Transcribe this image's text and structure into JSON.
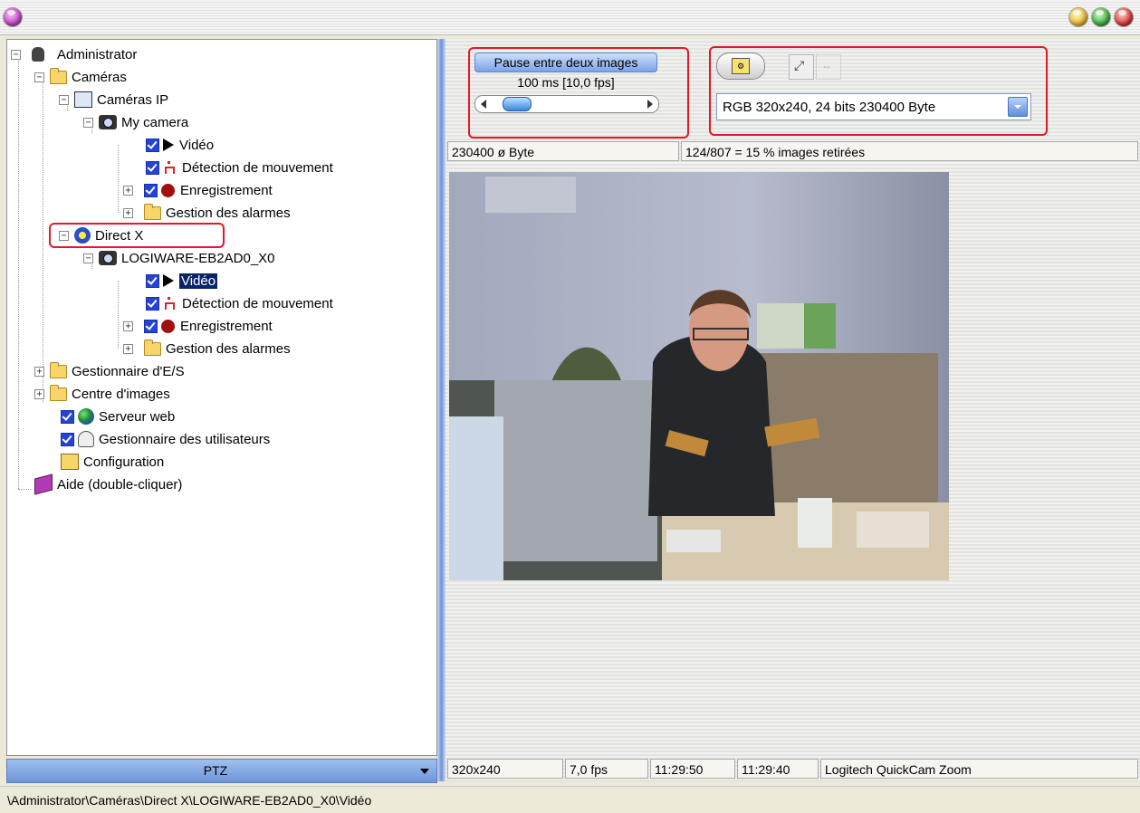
{
  "window": {
    "buttons": {
      "left": "#c94fcf",
      "yellow": "#f0c040",
      "green": "#45b845",
      "red": "#e04040"
    }
  },
  "tree": {
    "administrator": "Administrator",
    "cameras": "Caméras",
    "ip_cameras": "Caméras IP",
    "my_camera": "My camera",
    "video": "Vidéo",
    "motion": "Détection de mouvement",
    "recording": "Enregistrement",
    "alarms": "Gestion des alarmes",
    "directx": "Direct X",
    "device": "LOGIWARE-EB2AD0_X0",
    "video2": "Vidéo",
    "motion2": "Détection de mouvement",
    "recording2": "Enregistrement",
    "alarms2": "Gestion des alarmes",
    "io_manager": "Gestionnaire d'E/S",
    "image_center": "Centre d'images",
    "web_server": "Serveur web",
    "user_manager": "Gestionnaire des utilisateurs",
    "configuration": "Configuration",
    "help": "Aide (double-cliquer)"
  },
  "ptz": {
    "label": "PTZ"
  },
  "path": "\\Administrator\\Caméras\\Direct X\\LOGIWARE-EB2AD0_X0\\Vidéo",
  "pause": {
    "title": "Pause entre deux images",
    "value": "100 ms [10,0 fps]",
    "slider_fraction": 0.1
  },
  "format": {
    "selected": "RGB 320x240, 24 bits 230400 Byte"
  },
  "info": {
    "bytes": "230400 ø Byte",
    "dropped": "124/807 = 15 % images retirées"
  },
  "status": {
    "resolution": "320x240",
    "fps": "7,0 fps",
    "time1": "11:29:50",
    "time2": "11:29:40",
    "device": "Logitech QuickCam Zoom"
  },
  "colors": {
    "highlight": "#e0192b",
    "selection": "#0a246a"
  }
}
